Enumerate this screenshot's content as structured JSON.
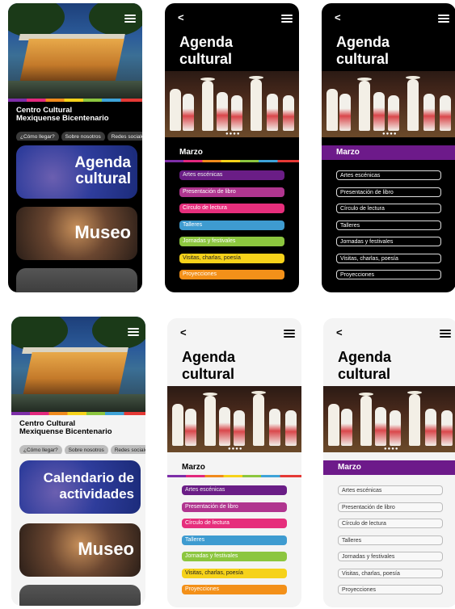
{
  "home": {
    "title_line1": "Centro Cultural",
    "title_line2": "Mexiquense Bicentenario",
    "chips": [
      "¿Cómo llegar?",
      "Sobre nosotros",
      "Redes sociales"
    ],
    "dark_cards": {
      "agenda": [
        "Agenda",
        "cultural"
      ],
      "museo": "Museo"
    },
    "light_cards": {
      "agenda": [
        "Calendario de",
        "actividades"
      ],
      "museo": "Museo"
    }
  },
  "agenda": {
    "back": "<",
    "title_line1": "Agenda",
    "title_line2": "cultural",
    "carousel_dots": "●●●●",
    "month": "Marzo",
    "categories": [
      "Artes escénicas",
      "Presentación de libro",
      "Círculo de lectura",
      "Talleres",
      "Jornadas y festivales",
      "Visitas, charlas, poesía",
      "Proyecciones"
    ]
  },
  "colors": {
    "purple": "#6d1a8a",
    "pink": "#e62e7c",
    "blue": "#3e9bd0",
    "green": "#8cc63f",
    "yellow": "#f6d21a",
    "orange": "#f39019"
  }
}
